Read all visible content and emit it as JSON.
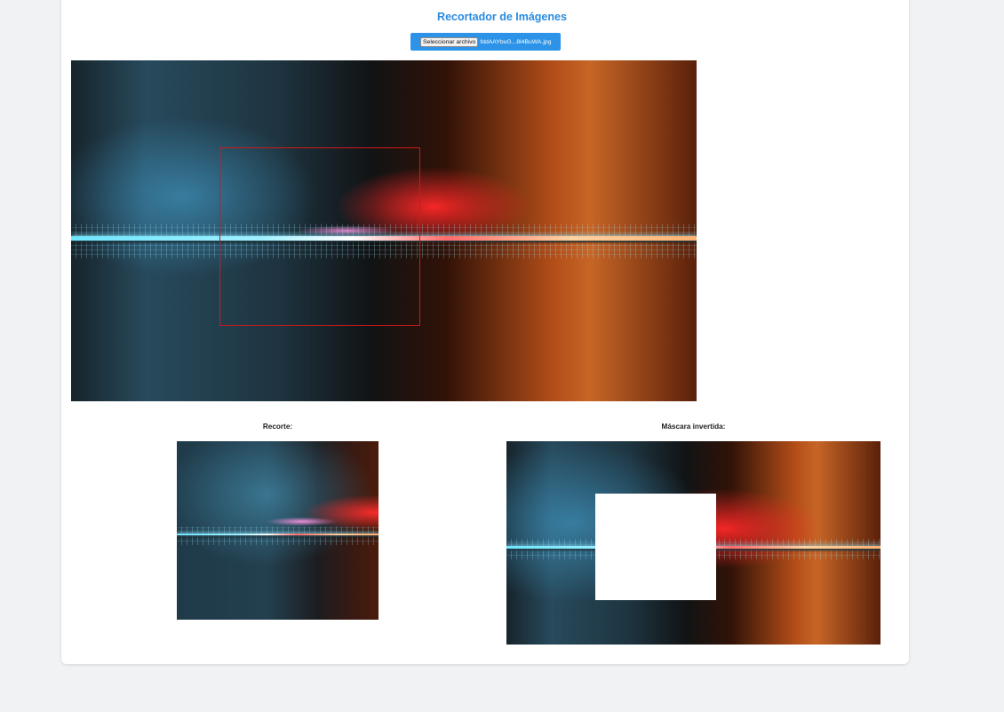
{
  "app": {
    "title": "Recortador de Imágenes"
  },
  "file_input": {
    "button_label": "Seleccionar archivo",
    "file_name": "fddAAYbuG...8l4BuWA.jpg"
  },
  "preview": {
    "crop_caption": "Recorte:",
    "mask_caption": "Máscara invertida:"
  },
  "colors": {
    "accent": "#2d93e8",
    "title": "#2a8be0",
    "selection_border": "#d01818",
    "page_background": "#f1f2f4"
  }
}
